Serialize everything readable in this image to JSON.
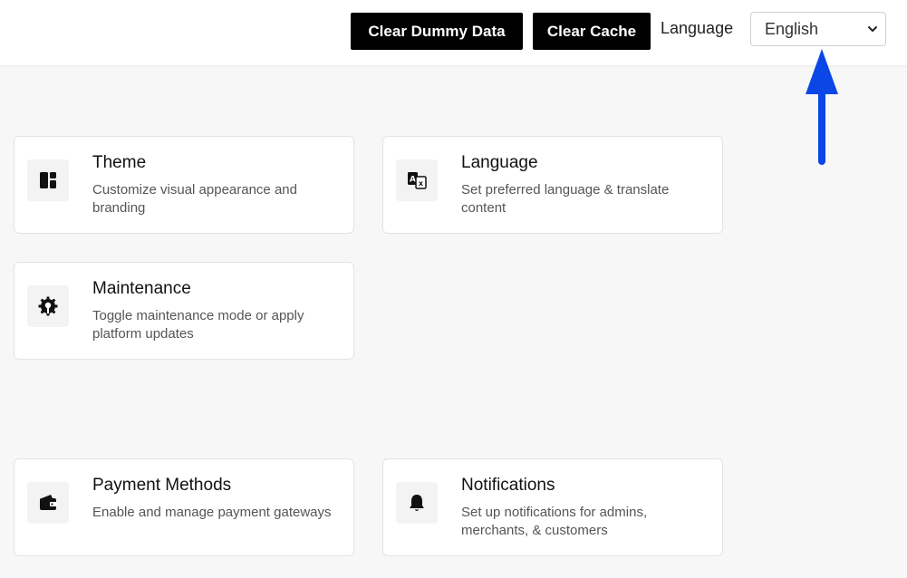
{
  "header": {
    "clear_dummy_label": "Clear Dummy Data",
    "clear_cache_label": "Clear Cache",
    "language_label": "Language",
    "language_selected": "English"
  },
  "cards": [
    {
      "title": "Theme",
      "description": "Customize visual appearance and branding",
      "icon": "theme-icon"
    },
    {
      "title": "Language",
      "description": "Set preferred language & translate content",
      "icon": "translate-icon"
    },
    {
      "title": "Maintenance",
      "description": "Toggle maintenance mode or apply platform updates",
      "icon": "gear-wrench-icon"
    },
    {
      "title": "Payment Methods",
      "description": "Enable and manage payment gateways",
      "icon": "wallet-icon"
    },
    {
      "title": "Notifications",
      "description": "Set up notifications for admins, merchants, & customers",
      "icon": "bell-icon"
    }
  ],
  "colors": {
    "button_bg": "#000000",
    "arrow": "#0b46e6",
    "page_bg": "#f7f7f7"
  }
}
